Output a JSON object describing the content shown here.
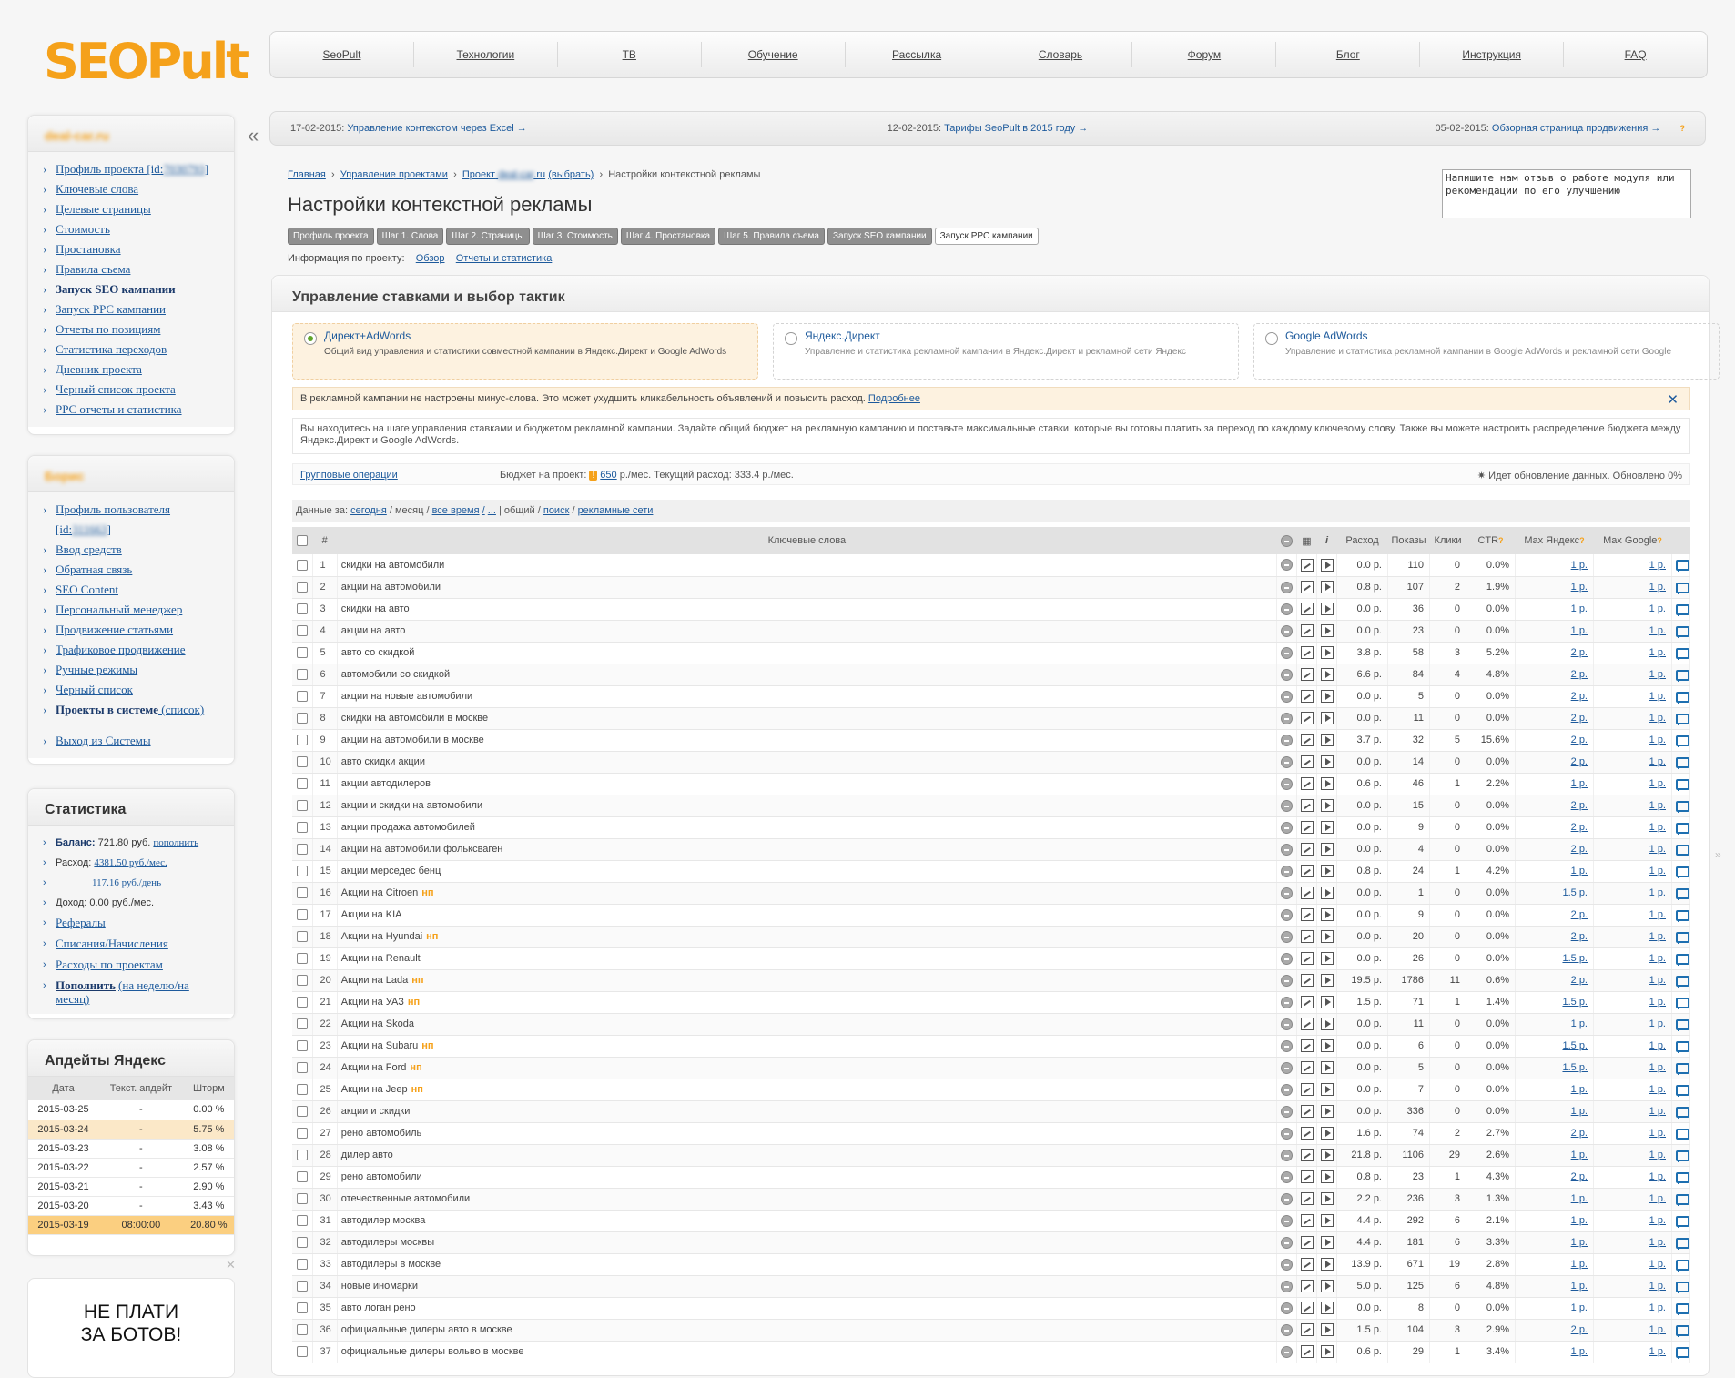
{
  "logo": {
    "text": "SEOPult"
  },
  "topnav": [
    "SeoPult",
    "Технологии",
    "ТВ",
    "Обучение",
    "Рассылка",
    "Словарь",
    "Форум",
    "Блог",
    "Инструкция",
    "FAQ"
  ],
  "news": [
    {
      "date": "17-02-2015:",
      "text": "Управление контекстом через Excel →"
    },
    {
      "date": "12-02-2015:",
      "text": "Тарифы SeoPult в 2015 году →"
    },
    {
      "date": "05-02-2015:",
      "text": "Обзорная страница продвижения →",
      "q": "?"
    }
  ],
  "collapse": "«",
  "project_box": {
    "name": "deal-car.ru",
    "items": [
      {
        "text": "Профиль проекта [id:",
        "blur": "7030793",
        "suffix": "]"
      },
      {
        "text": "Ключевые слова"
      },
      {
        "text": "Целевые страницы"
      },
      {
        "text": "Стоимость"
      },
      {
        "text": "Простановка"
      },
      {
        "text": "Правила съема"
      },
      {
        "text": "Запуск SEO кампании",
        "bold": true
      },
      {
        "text": "Запуск PPC кампании"
      },
      {
        "text": "Отчеты по позициям"
      },
      {
        "text": "Статистика переходов"
      },
      {
        "text": "Дневник проекта"
      },
      {
        "text": "Черный список проекта"
      },
      {
        "text": "PPC отчеты и статистика"
      }
    ]
  },
  "user_box": {
    "name": "Борис",
    "items": [
      {
        "text": "Профиль пользователя [id:",
        "blur": "311663",
        "suffix": "]"
      },
      {
        "text": "Ввод средств"
      },
      {
        "text": "Обратная связь"
      },
      {
        "text": "SEO Content"
      },
      {
        "text": "Персональный менеджер"
      },
      {
        "text": "Продвижение статьями"
      },
      {
        "text": "Трафиковое продвижение"
      },
      {
        "text": "Ручные режимы"
      },
      {
        "text": "Черный список"
      },
      {
        "text": "Проекты в системе",
        "bold": true,
        "suffix": " (список)"
      },
      {
        "text": ""
      },
      {
        "text": "Выход из Системы"
      }
    ]
  },
  "stats": {
    "title": "Статистика",
    "balance_label": "Баланс:",
    "balance": "721.80 руб.",
    "balance_link": "пополнить",
    "expense_label": "Расход:",
    "expense_month": "4381.50 руб./мес.",
    "expense_day": "117.16 руб./день",
    "income": "Доход: 0.00 руб./мес.",
    "links": [
      "Рефералы",
      "Списания/Начисления",
      "Расходы по проектам"
    ],
    "topup": "Пополнить",
    "topup_suffix": "(на неделю/на месяц)"
  },
  "updates": {
    "title": "Апдейты Яндекс",
    "headers": [
      "Дата",
      "Текст. апдейт",
      "Шторм"
    ],
    "rows": [
      {
        "date": "2015-03-25",
        "text": "-",
        "storm": "0.00 %",
        "hl": ""
      },
      {
        "date": "2015-03-24",
        "text": "-",
        "storm": "5.75 %",
        "hl": "hl"
      },
      {
        "date": "2015-03-23",
        "text": "-",
        "storm": "3.08 %",
        "hl": ""
      },
      {
        "date": "2015-03-22",
        "text": "-",
        "storm": "2.57 %",
        "hl": ""
      },
      {
        "date": "2015-03-21",
        "text": "-",
        "storm": "2.90 %",
        "hl": ""
      },
      {
        "date": "2015-03-20",
        "text": "-",
        "storm": "3.43 %",
        "hl": ""
      },
      {
        "date": "2015-03-19",
        "text": "08:00:00",
        "storm": "20.80 %",
        "hl": "hl2"
      }
    ]
  },
  "ad": {
    "line1": "НЕ ПЛАТИ",
    "line2": "ЗА БОТОВ!",
    "close": "✕"
  },
  "feedback_placeholder": "Напишите нам отзыв о работе модуля или рекомендации по его улучшению",
  "breadcrumb": {
    "home": "Главная",
    "projects": "Управление проектами",
    "project": "Проект",
    "project_blur": "deal-car",
    "project_tail": ".ru",
    "choose": "(выбрать)",
    "current": "Настройки контекстной рекламы"
  },
  "title": "Настройки контекстной рекламы",
  "steps": [
    "Профиль проекта",
    "Шаг 1. Слова",
    "Шаг 2. Страницы",
    "Шаг 3. Стоимость",
    "Шаг 4. Простановка",
    "Шаг 5. Правила съема",
    "Запуск SEO кампании",
    "Запуск PPC кампании"
  ],
  "project_info": {
    "label": "Информация по проекту:",
    "links": [
      "Обзор",
      "Отчеты и статистика"
    ]
  },
  "panel_title": "Управление ставками и выбор тактик",
  "tactics": [
    {
      "title": "Директ+AdWords",
      "desc": "Общий вид управления и статистики совместной кампании в Яндекс.Директ и Google AdWords",
      "selected": true
    },
    {
      "title": "Яндекс.Директ",
      "desc": "Управление и статистика рекламной кампании в Яндекс.Директ и рекламной сети Яндекс",
      "selected": false
    },
    {
      "title": "Google AdWords",
      "desc": "Управление и статистика рекламной кампании в Google AdWords и рекламной сети Google",
      "selected": false
    }
  ],
  "warning": {
    "text": "В рекламной кампании не настроены минус-слова. Это может ухудшить кликабельность объявлений и повысить расход.",
    "link": "Подробнее",
    "close": "✕"
  },
  "info_text": "Вы находитесь на шаге управления ставками и бюджетом рекламной кампании. Задайте общий бюджет на рекламную кампанию и поставьте максимальные ставки, которые вы готовы платить за переход по каждому ключевому слову. Также вы можете настроить распределение бюджета между Яндекс.Директ и Google AdWords.",
  "budget": {
    "group_ops": "Групповые операции",
    "label": "Бюджет на проект:",
    "badge": "!",
    "value": "650",
    "unit": "р./мес. Текущий расход: 333.4 р./мес.",
    "status": "Идет обновление данных. Обновлено 0%"
  },
  "filter": {
    "label": "Данные за:",
    "today": "сегодня",
    "month": "месяц",
    "all": "все время",
    "dots": "...",
    "general": "общий",
    "search": "поиск",
    "networks": "рекламные сети"
  },
  "table": {
    "headers": {
      "num": "#",
      "kw": "Ключевые слова",
      "cost": "Расход",
      "shows": "Показы",
      "clicks": "Клики",
      "ctr": "CTR",
      "maxy": "Max Яндекс",
      "maxg": "Max Google",
      "q": "?"
    },
    "rows": [
      {
        "n": "1",
        "kw": "скидки на автомобили",
        "np": "",
        "cost": "0.0 р.",
        "shows": "110",
        "clicks": "0",
        "ctr": "0.0%",
        "my": "1 р.",
        "mg": "1 р."
      },
      {
        "n": "2",
        "kw": "акции на автомобили",
        "np": "",
        "cost": "0.8 р.",
        "shows": "107",
        "clicks": "2",
        "ctr": "1.9%",
        "my": "1 р.",
        "mg": "1 р."
      },
      {
        "n": "3",
        "kw": "скидки на авто",
        "np": "",
        "cost": "0.0 р.",
        "shows": "36",
        "clicks": "0",
        "ctr": "0.0%",
        "my": "1 р.",
        "mg": "1 р."
      },
      {
        "n": "4",
        "kw": "акции на авто",
        "np": "",
        "cost": "0.0 р.",
        "shows": "23",
        "clicks": "0",
        "ctr": "0.0%",
        "my": "1 р.",
        "mg": "1 р."
      },
      {
        "n": "5",
        "kw": "авто со скидкой",
        "np": "",
        "cost": "3.8 р.",
        "shows": "58",
        "clicks": "3",
        "ctr": "5.2%",
        "my": "2 р.",
        "mg": "1 р."
      },
      {
        "n": "6",
        "kw": "автомобили со скидкой",
        "np": "",
        "cost": "6.6 р.",
        "shows": "84",
        "clicks": "4",
        "ctr": "4.8%",
        "my": "2 р.",
        "mg": "1 р."
      },
      {
        "n": "7",
        "kw": "акции на новые автомобили",
        "np": "",
        "cost": "0.0 р.",
        "shows": "5",
        "clicks": "0",
        "ctr": "0.0%",
        "my": "2 р.",
        "mg": "1 р."
      },
      {
        "n": "8",
        "kw": "скидки на автомобили в москве",
        "np": "",
        "cost": "0.0 р.",
        "shows": "11",
        "clicks": "0",
        "ctr": "0.0%",
        "my": "2 р.",
        "mg": "1 р."
      },
      {
        "n": "9",
        "kw": "акции на автомобили в москве",
        "np": "",
        "cost": "3.7 р.",
        "shows": "32",
        "clicks": "5",
        "ctr": "15.6%",
        "my": "2 р.",
        "mg": "1 р."
      },
      {
        "n": "10",
        "kw": "авто скидки акции",
        "np": "",
        "cost": "0.0 р.",
        "shows": "14",
        "clicks": "0",
        "ctr": "0.0%",
        "my": "2 р.",
        "mg": "1 р."
      },
      {
        "n": "11",
        "kw": "акции автодилеров",
        "np": "",
        "cost": "0.6 р.",
        "shows": "46",
        "clicks": "1",
        "ctr": "2.2%",
        "my": "1 р.",
        "mg": "1 р."
      },
      {
        "n": "12",
        "kw": "акции и скидки на автомобили",
        "np": "",
        "cost": "0.0 р.",
        "shows": "15",
        "clicks": "0",
        "ctr": "0.0%",
        "my": "2 р.",
        "mg": "1 р."
      },
      {
        "n": "13",
        "kw": "акции продажа автомобилей",
        "np": "",
        "cost": "0.0 р.",
        "shows": "9",
        "clicks": "0",
        "ctr": "0.0%",
        "my": "2 р.",
        "mg": "1 р."
      },
      {
        "n": "14",
        "kw": "акции на автомобили фольксваген",
        "np": "",
        "cost": "0.0 р.",
        "shows": "4",
        "clicks": "0",
        "ctr": "0.0%",
        "my": "2 р.",
        "mg": "1 р."
      },
      {
        "n": "15",
        "kw": "акции мерседес бенц",
        "np": "",
        "cost": "0.8 р.",
        "shows": "24",
        "clicks": "1",
        "ctr": "4.2%",
        "my": "1 р.",
        "mg": "1 р."
      },
      {
        "n": "16",
        "kw": "Акции на Citroen",
        "np": "нп",
        "cost": "0.0 р.",
        "shows": "1",
        "clicks": "0",
        "ctr": "0.0%",
        "my": "1.5 р.",
        "mg": "1 р."
      },
      {
        "n": "17",
        "kw": "Акции на KIA",
        "np": "",
        "cost": "0.0 р.",
        "shows": "9",
        "clicks": "0",
        "ctr": "0.0%",
        "my": "2 р.",
        "mg": "1 р."
      },
      {
        "n": "18",
        "kw": "Акции на Hyundai",
        "np": "нп",
        "cost": "0.0 р.",
        "shows": "20",
        "clicks": "0",
        "ctr": "0.0%",
        "my": "2 р.",
        "mg": "1 р."
      },
      {
        "n": "19",
        "kw": "Акции на Renault",
        "np": "",
        "cost": "0.0 р.",
        "shows": "26",
        "clicks": "0",
        "ctr": "0.0%",
        "my": "1.5 р.",
        "mg": "1 р."
      },
      {
        "n": "20",
        "kw": "Акции на Lada",
        "np": "нп",
        "cost": "19.5 р.",
        "shows": "1786",
        "clicks": "11",
        "ctr": "0.6%",
        "my": "2 р.",
        "mg": "1 р."
      },
      {
        "n": "21",
        "kw": "Акции на УАЗ",
        "np": "нп",
        "cost": "1.5 р.",
        "shows": "71",
        "clicks": "1",
        "ctr": "1.4%",
        "my": "1.5 р.",
        "mg": "1 р."
      },
      {
        "n": "22",
        "kw": "Акции на Skoda",
        "np": "",
        "cost": "0.0 р.",
        "shows": "11",
        "clicks": "0",
        "ctr": "0.0%",
        "my": "1 р.",
        "mg": "1 р."
      },
      {
        "n": "23",
        "kw": "Акции на Subaru",
        "np": "нп",
        "cost": "0.0 р.",
        "shows": "6",
        "clicks": "0",
        "ctr": "0.0%",
        "my": "1.5 р.",
        "mg": "1 р."
      },
      {
        "n": "24",
        "kw": "Акции на Ford",
        "np": "нп",
        "cost": "0.0 р.",
        "shows": "5",
        "clicks": "0",
        "ctr": "0.0%",
        "my": "1.5 р.",
        "mg": "1 р."
      },
      {
        "n": "25",
        "kw": "Акции на Jeep",
        "np": "нп",
        "cost": "0.0 р.",
        "shows": "7",
        "clicks": "0",
        "ctr": "0.0%",
        "my": "1 р.",
        "mg": "1 р."
      },
      {
        "n": "26",
        "kw": "акции и скидки",
        "np": "",
        "cost": "0.0 р.",
        "shows": "336",
        "clicks": "0",
        "ctr": "0.0%",
        "my": "1 р.",
        "mg": "1 р."
      },
      {
        "n": "27",
        "kw": "рено автомобиль",
        "np": "",
        "cost": "1.6 р.",
        "shows": "74",
        "clicks": "2",
        "ctr": "2.7%",
        "my": "2 р.",
        "mg": "1 р."
      },
      {
        "n": "28",
        "kw": "дилер авто",
        "np": "",
        "cost": "21.8 р.",
        "shows": "1106",
        "clicks": "29",
        "ctr": "2.6%",
        "my": "1 р.",
        "mg": "1 р."
      },
      {
        "n": "29",
        "kw": "рено автомобили",
        "np": "",
        "cost": "0.8 р.",
        "shows": "23",
        "clicks": "1",
        "ctr": "4.3%",
        "my": "2 р.",
        "mg": "1 р."
      },
      {
        "n": "30",
        "kw": "отечественные автомобили",
        "np": "",
        "cost": "2.2 р.",
        "shows": "236",
        "clicks": "3",
        "ctr": "1.3%",
        "my": "1 р.",
        "mg": "1 р."
      },
      {
        "n": "31",
        "kw": "автодилер москва",
        "np": "",
        "cost": "4.4 р.",
        "shows": "292",
        "clicks": "6",
        "ctr": "2.1%",
        "my": "1 р.",
        "mg": "1 р."
      },
      {
        "n": "32",
        "kw": "автодилеры москвы",
        "np": "",
        "cost": "4.4 р.",
        "shows": "181",
        "clicks": "6",
        "ctr": "3.3%",
        "my": "1 р.",
        "mg": "1 р."
      },
      {
        "n": "33",
        "kw": "автодилеры в москве",
        "np": "",
        "cost": "13.9 р.",
        "shows": "671",
        "clicks": "19",
        "ctr": "2.8%",
        "my": "1 р.",
        "mg": "1 р."
      },
      {
        "n": "34",
        "kw": "новые иномарки",
        "np": "",
        "cost": "5.0 р.",
        "shows": "125",
        "clicks": "6",
        "ctr": "4.8%",
        "my": "1 р.",
        "mg": "1 р."
      },
      {
        "n": "35",
        "kw": "авто логан рено",
        "np": "",
        "cost": "0.0 р.",
        "shows": "8",
        "clicks": "0",
        "ctr": "0.0%",
        "my": "1 р.",
        "mg": "1 р."
      },
      {
        "n": "36",
        "kw": "официальные дилеры авто в москве",
        "np": "",
        "cost": "1.5 р.",
        "shows": "104",
        "clicks": "3",
        "ctr": "2.9%",
        "my": "2 р.",
        "mg": "1 р."
      },
      {
        "n": "37",
        "kw": "официальные дилеры вольво в москве",
        "np": "",
        "cost": "0.6 р.",
        "shows": "29",
        "clicks": "1",
        "ctr": "3.4%",
        "my": "1 р.",
        "mg": "1 р."
      }
    ]
  },
  "colors": {
    "accent": "#f5a11a",
    "link": "#1d5a9c",
    "warn_bg": "#fdf2e0"
  }
}
